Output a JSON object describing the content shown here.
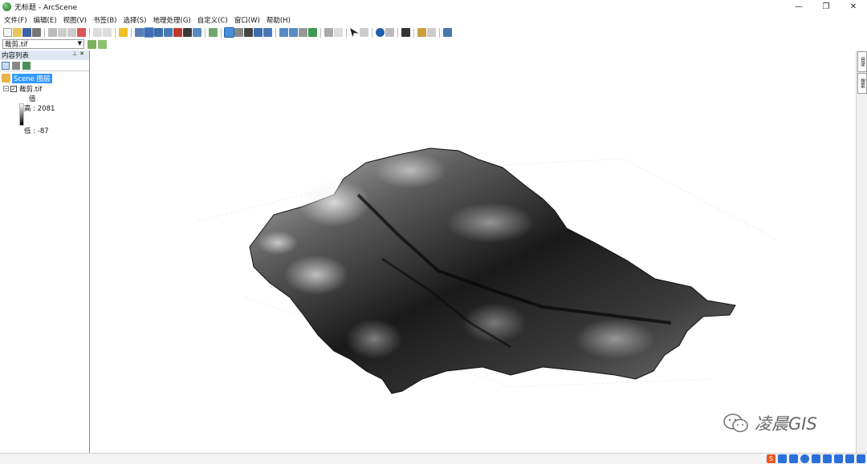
{
  "window": {
    "title": "无标题 - ArcScene"
  },
  "menu": [
    "文件(F)",
    "编辑(E)",
    "视图(V)",
    "书签(B)",
    "选择(S)",
    "地理处理(G)",
    "自定义(C)",
    "窗口(W)",
    "帮助(H)"
  ],
  "layer_selector": {
    "value": "裁剪.tif"
  },
  "toc": {
    "title": "内容列表",
    "scene_label": "Scene 图层",
    "layer_name": "裁剪.tif",
    "legend_title": "值",
    "legend_high": "高 : 2081",
    "legend_low": "低 : -87"
  },
  "watermark": {
    "text": "凌晨GIS"
  }
}
